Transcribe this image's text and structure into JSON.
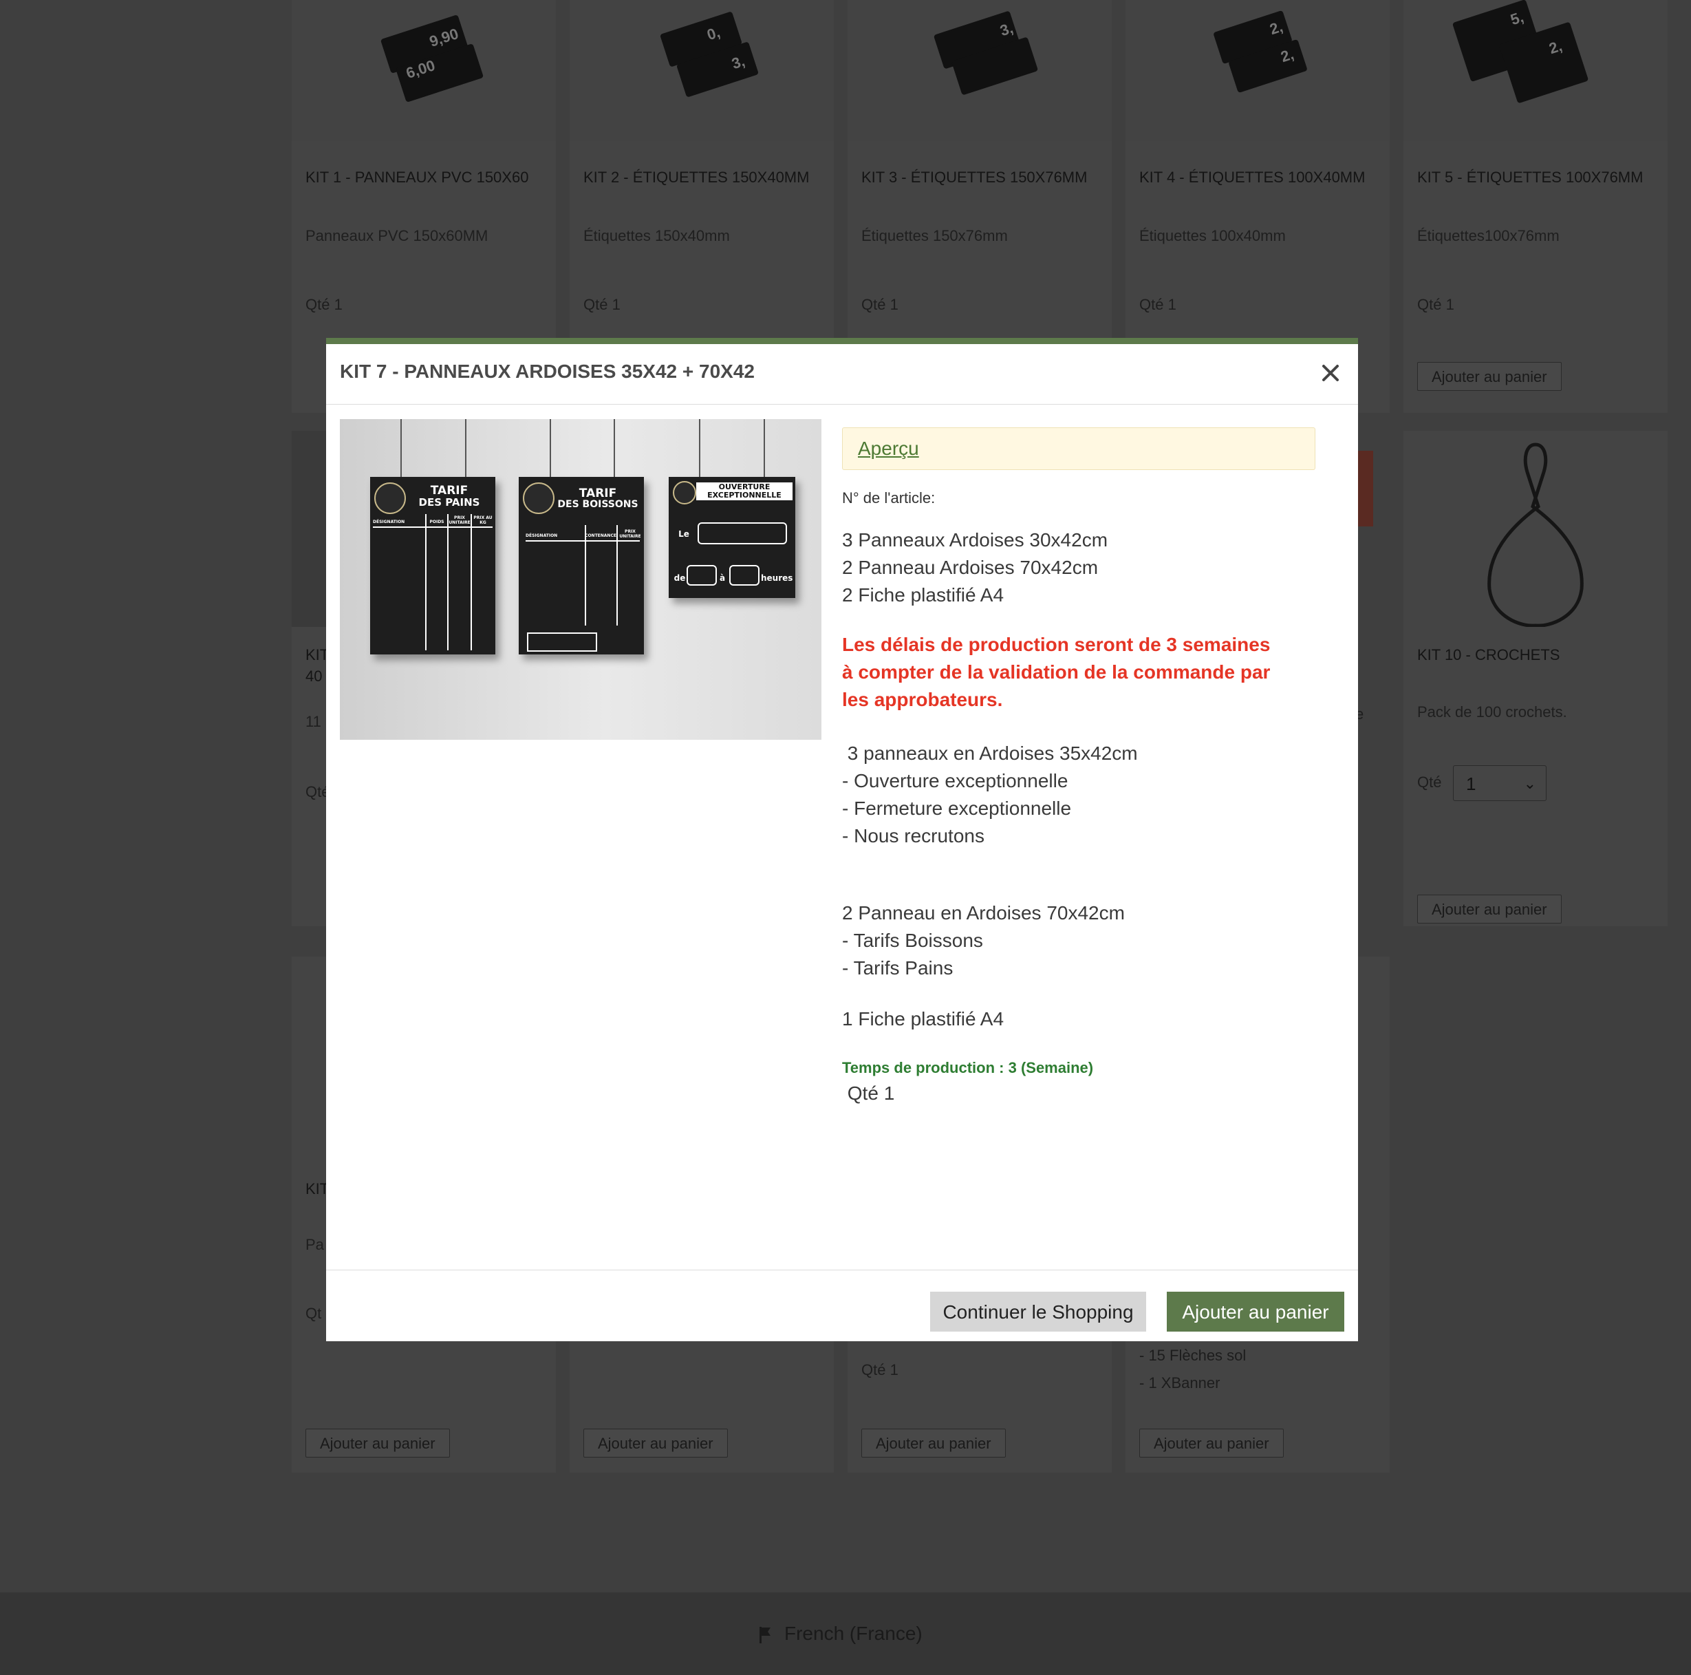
{
  "background": {
    "cards_row1": [
      {
        "title": "KIT 1 - PANNEAUX PVC 150X60",
        "desc": "Panneaux PVC 150x60MM",
        "qty": "Qté 1",
        "tag_texts": [
          "9,90",
          "6,00"
        ]
      },
      {
        "title": "KIT 2 - ÉTIQUETTES 150X40MM",
        "desc": "Étiquettes 150x40mm",
        "qty": "Qté 1",
        "tag_texts": [
          "0,",
          "3,"
        ]
      },
      {
        "title": "KIT 3 - ÉTIQUETTES 150X76MM",
        "desc": "Étiquettes 150x76mm",
        "qty": "Qté 1",
        "tag_texts": [
          "3,",
          ""
        ]
      },
      {
        "title": "KIT 4 - ÉTIQUETTES 100X40MM",
        "desc": "Étiquettes 100x40mm",
        "qty": "Qté 1",
        "tag_texts": [
          "2,",
          "2,"
        ]
      },
      {
        "title": "KIT 5 - ÉTIQUETTES 100X76MM",
        "desc": "Étiquettes100x76mm",
        "qty": "Qté 1",
        "tag_texts": [
          "5,",
          "2,"
        ],
        "add_label": "Ajouter au panier"
      }
    ],
    "row2_left": {
      "title_partial": "KIT",
      "title_partial2": "40",
      "desc_partial": "11",
      "qty_partial": "Qté"
    },
    "row2_right": {
      "title": "KIT 10 - CROCHETS",
      "desc": "Pack de 100 crochets.",
      "qty_label": "Qté",
      "qty_value": "1",
      "add_label": "Ajouter au panier",
      "partial_text": "e"
    },
    "row3": [
      {
        "title_partial": "KIT",
        "desc_partial": "Pa",
        "qty_partial": "Qt",
        "add_label": "Ajouter au panier"
      },
      {
        "add_label": "Ajouter au panier"
      },
      {
        "qty": "Qté 1",
        "add_label": "Ajouter au panier"
      },
      {
        "extra_lines": [
          "- 15 Flèches sol",
          "- 1 XBanner"
        ],
        "add_label": "Ajouter au panier"
      }
    ],
    "footer": {
      "language": "French (France)"
    }
  },
  "modal": {
    "title": "KIT 7 - PANNEAUX ARDOISES 35X42 + 70X42",
    "image": {
      "boards": [
        {
          "title1": "TARIF",
          "title2": "DES PAINS",
          "cols": [
            "DÉSIGNATION",
            "POIDS",
            "PRIX UNITAIRE",
            "PRIX AU KG"
          ]
        },
        {
          "title1": "TARIF",
          "title2": "DES BOISSONS",
          "cols": [
            "DÉSIGNATION",
            "CONTENANCE",
            "PRIX UNITAIRE"
          ]
        },
        {
          "title1": "OUVERTURE",
          "title2": "EXCEPTIONNELLE",
          "labels": [
            "Le",
            "de",
            "à",
            "heures"
          ]
        }
      ]
    },
    "apercu_link": "Aperçu",
    "article_no_label": "N° de l'article:",
    "summary_lines": "3 Panneaux Ardoises 30x42cm\n2 Panneau Ardoises 70x42cm\n2 Fiche plastifié A4",
    "warning": "Les délais de production seront de 3 semaines à compter de la validation de la commande par les approbateurs.",
    "details_block1": " 3 panneaux en Ardoises 35x42cm\n- Ouverture exceptionnelle\n- Fermeture exceptionnelle\n- Nous recrutons",
    "details_block2": "2 Panneau en Ardoises 70x42cm\n- Tarifs Boissons\n- Tarifs Pains",
    "details_block3": "1 Fiche plastifié A4",
    "production_time": "Temps de production : 3 (Semaine)",
    "qty": " Qté 1",
    "continue_label": "Continuer le Shopping",
    "add_label": "Ajouter au panier",
    "accent_color": "#5d7a4b",
    "warning_color": "#e53525"
  }
}
